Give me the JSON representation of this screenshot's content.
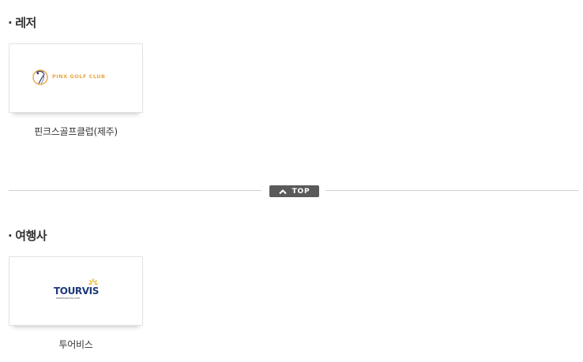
{
  "sections": [
    {
      "title": "레저",
      "items": [
        {
          "label": "핀크스골프클럽(제주)",
          "logo_text": "PINX GOLF CLUB",
          "logo_color": "#e8a640"
        }
      ]
    },
    {
      "title": "여행사",
      "items": [
        {
          "label": "투어비스",
          "logo_text": "TOURVIS",
          "logo_sub": "www.tourvis.com",
          "logo_color": "#1f3a7a",
          "accent_color": "#f2a900"
        }
      ]
    }
  ],
  "top_button": {
    "label": "TOP",
    "icon": "chevron-up-icon"
  }
}
